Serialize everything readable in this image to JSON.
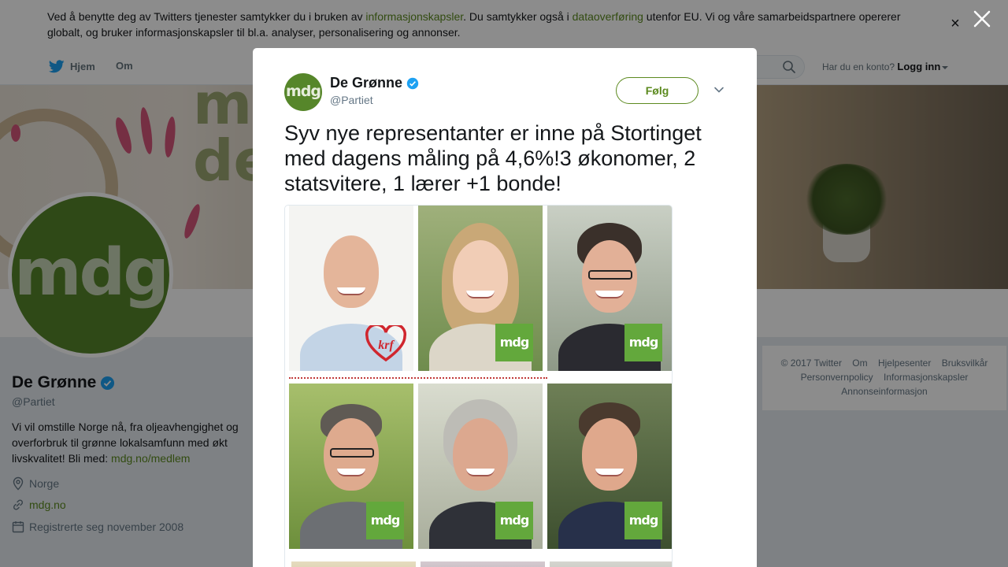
{
  "cookie_banner": {
    "text_1": "Ved å benytte deg av Twitters tjenester samtykker du i bruken av ",
    "link_1": "informasjonskapsler",
    "text_2": ". Du samtykker også i ",
    "link_2": "dataoverføring",
    "text_3": " utenfor EU. Vi og våre samarbeidspartnere opererer globalt, og bruker informasjonskapsler til bl.a. analyser, personalisering og annonser.",
    "close": "×"
  },
  "topnav": {
    "home": "Hjem",
    "about": "Om",
    "account_question": "Har du en konto?",
    "login": "Logg inn"
  },
  "header_image": {
    "word_1": "mi",
    "word_2": "de"
  },
  "profile": {
    "avatar_text": "mdg",
    "name": "De Grønne",
    "handle": "@Partiet",
    "bio": "Vi vil omstille Norge nå, fra oljeavhengighet og overforbruk til grønne lokalsamfunn med økt livskvalitet! Bli med: ",
    "bio_link": "mdg.no/medlem",
    "location": "Norge",
    "website": "mdg.no",
    "joined": "Registrerte seg november 2008"
  },
  "footer": {
    "items": [
      "© 2017 Twitter",
      "Om",
      "Hjelpesenter",
      "Bruksvilkår",
      "Personvernpolicy",
      "Informasjonskapsler",
      "Annonseinformasjon"
    ]
  },
  "modal": {
    "avatar_text": "mdg",
    "name": "De Grønne",
    "handle": "@Partiet",
    "follow": "Følg",
    "tweet_text": "Syv nye representanter er inne på Stortinget med dagens måling på 4,6%!3 økonomer, 2 statsvitere, 1 lærer +1 bonde!",
    "badge_text": "mdg",
    "krf_text": "krf"
  },
  "colors": {
    "link": "#5c8a1f",
    "brand": "#56862a",
    "badge": "#63a83c",
    "verified": "#1da1f2",
    "twitter_blue": "#1da1f2"
  },
  "icons": {
    "close_overlay": "close-icon",
    "search": "search-icon",
    "location": "location-pin-icon",
    "link": "link-icon",
    "calendar": "calendar-icon",
    "verified": "verified-badge-icon",
    "chevron": "chevron-down-icon",
    "bird": "twitter-bird-icon"
  }
}
